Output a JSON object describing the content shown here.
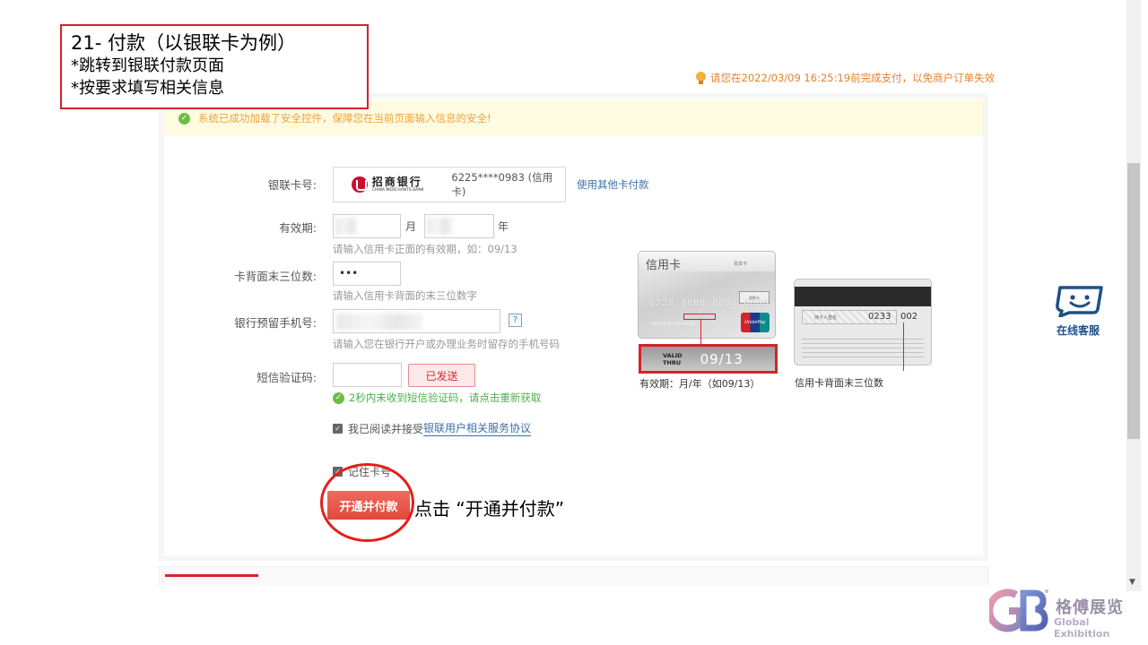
{
  "callout": {
    "title": "21- 付款（以银联卡为例）",
    "line1": "*跳转到银联付款页面",
    "line2": "*按要求填写相关信息"
  },
  "deadline": "请您在2022/03/09 16:25:19前完成支付，以免商户订单失效",
  "notice": "系统已成功加载了安全控件，保障您在当前页面输入信息的安全!",
  "form": {
    "card_label": "银联卡号:",
    "bank_name": "招商银行",
    "bank_en": "CHINA MERCHANTS BANK",
    "card_number": "6225****0983 (信用卡)",
    "other_card_link": "使用其他卡付款",
    "expiry_label": "有效期:",
    "month_unit": "月",
    "year_unit": "年",
    "expiry_hint": "请输入信用卡正面的有效期，如：09/13",
    "cvv_label": "卡背面末三位数:",
    "cvv_value": "•••",
    "cvv_hint": "请输入信用卡背面的末三位数字",
    "phone_label": "银行预留手机号:",
    "phone_help": "?",
    "phone_hint": "请输入您在银行开户或办理业务时留存的手机号码",
    "sms_label": "短信验证码:",
    "sms_button": "已发送",
    "sms_note": "2秒内未收到短信验证码，请点击重新获取",
    "agree_text": "我已阅读并接受",
    "agree_link": "银联用户相关服务协议",
    "remember_text": "记住卡号",
    "pay_button": "开通并付款"
  },
  "click_note": "点击 “开通并付款”",
  "card_front": {
    "title": "信用卡",
    "tag": "贵宾卡",
    "bank_small": "银联卡",
    "number": "6228 8888 8888 8888",
    "holder": "CARDHOLDER NAME",
    "unionpay": "UnionPay",
    "valid": "VALID",
    "thru": "THRU",
    "date": "09/13",
    "caption": "有效期：月/年（如09/13）"
  },
  "card_back": {
    "sig_text": "持卡人签名",
    "cvv_prefix": "0233",
    "cvv": "002",
    "caption": "信用卡背面末三位数"
  },
  "service": {
    "label": "在线客服"
  },
  "logo": {
    "cn": "格傅展览",
    "en": "Global Exhibition"
  },
  "colors": {
    "accent_red": "#d6222a",
    "warn_orange": "#e4812c",
    "link_blue": "#3d6fa8",
    "success_green": "#4caf4c"
  }
}
